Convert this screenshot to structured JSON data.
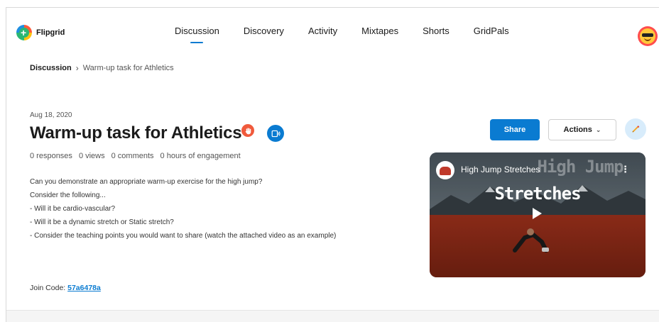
{
  "app": {
    "name": "Flipgrid"
  },
  "nav": {
    "items": [
      {
        "label": "Discussion",
        "active": true
      },
      {
        "label": "Discovery",
        "active": false
      },
      {
        "label": "Activity",
        "active": false
      },
      {
        "label": "Mixtapes",
        "active": false
      },
      {
        "label": "Shorts",
        "active": false
      },
      {
        "label": "GridPals",
        "active": false
      }
    ]
  },
  "breadcrumb": {
    "parent": "Discussion",
    "separator": "›",
    "current": "Warm-up task for Athletics"
  },
  "topic": {
    "date": "Aug 18, 2020",
    "title": "Warm-up task for Athletics",
    "stats": [
      "0 responses",
      "0 views",
      "0 comments",
      "0 hours of engagement"
    ],
    "prompt": [
      "Can you demonstrate an appropriate warm-up exercise for the high jump?",
      "Consider the following...",
      "- Will it be cardio-vascular?",
      "- Will it be a dynamic stretch or Static stretch?",
      "- Consider the teaching points you would want to share (watch the attached video as an example)"
    ],
    "join_label": "Join Code:",
    "join_code": "57a6478a"
  },
  "actions": {
    "share_label": "Share",
    "actions_label": "Actions"
  },
  "video": {
    "title": "High Jump Stretches",
    "overlay_line1": "High Jump",
    "overlay_line2": "Stretches"
  },
  "colors": {
    "accent": "#0a7bd1",
    "hand": "#f05a3c"
  },
  "icons": [
    "hand-icon",
    "closed-captions-icon",
    "pencil-icon",
    "play-icon",
    "more-vertical-icon",
    "chevron-down-icon"
  ]
}
